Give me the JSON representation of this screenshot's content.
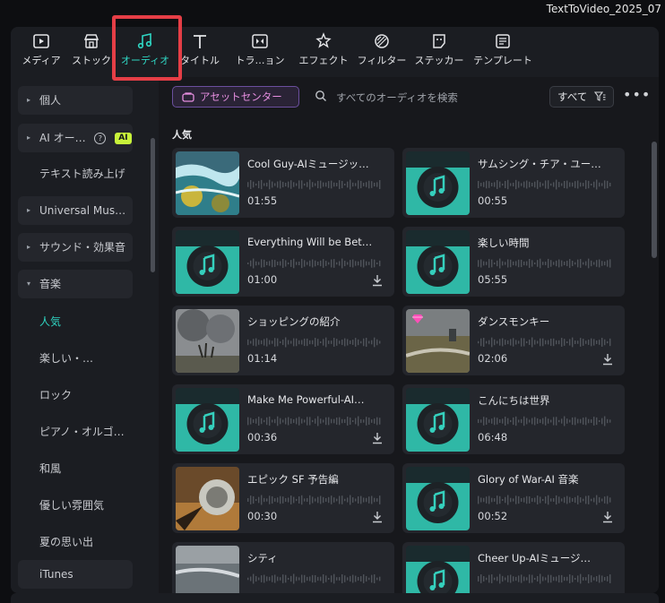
{
  "window": {
    "title": "TextToVideo_2025_07"
  },
  "toolbar": {
    "tabs": [
      {
        "label": "メディア",
        "icon": "media-icon"
      },
      {
        "label": "ストック",
        "icon": "stock-icon"
      },
      {
        "label": "オーディオ",
        "icon": "audio-icon",
        "active": true
      },
      {
        "label": "タイトル",
        "icon": "title-icon"
      },
      {
        "label": "トラ…ョン",
        "icon": "transition-icon"
      },
      {
        "label": "エフェクト",
        "icon": "effect-icon"
      },
      {
        "label": "フィルター",
        "icon": "filter-icon"
      },
      {
        "label": "ステッカー",
        "icon": "sticker-icon"
      },
      {
        "label": "テンプレート",
        "icon": "template-icon"
      }
    ]
  },
  "sidebar": {
    "items": [
      {
        "label": "個人",
        "arrow": "▸"
      },
      {
        "label": "AI オー…",
        "arrow": "▸",
        "help": "?",
        "badge": "AI"
      },
      {
        "label": "テキスト読み上げ"
      },
      {
        "label": "Universal Mus…",
        "arrow": "▸"
      },
      {
        "label": "サウンド・効果音",
        "arrow": "▸"
      },
      {
        "label": "音楽",
        "arrow": "▾"
      }
    ],
    "subitems": [
      {
        "label": "人気",
        "active": true
      },
      {
        "label": "楽しい・…"
      },
      {
        "label": "ロック"
      },
      {
        "label": "ピアノ・オルゴ…"
      },
      {
        "label": "和風"
      },
      {
        "label": "優しい雰囲気"
      },
      {
        "label": "夏の思い出"
      }
    ],
    "itunes": "iTunes"
  },
  "main": {
    "asset_center_label": "アセットセンター",
    "search_placeholder": "すべてのオーディオを検索",
    "filter_label": "すべて",
    "more_label": "•••",
    "section_title": "人気",
    "cards": [
      {
        "title": "Cool Guy-AIミュージッ…",
        "duration": "01:55",
        "thumb": "waves",
        "download": false
      },
      {
        "title": "サムシング・チア・ユー…",
        "duration": "00:55",
        "thumb": "disc",
        "download": false
      },
      {
        "title": "Everything Will be Bet…",
        "duration": "01:00",
        "thumb": "disc",
        "download": true
      },
      {
        "title": "楽しい時間",
        "duration": "05:55",
        "thumb": "disc",
        "download": false
      },
      {
        "title": "ショッピングの紹介",
        "duration": "01:14",
        "thumb": "storm",
        "download": false
      },
      {
        "title": "ダンスモンキー",
        "duration": "02:06",
        "thumb": "field",
        "download": true,
        "premium": true
      },
      {
        "title": "Make Me Powerful-AI…",
        "duration": "00:36",
        "thumb": "disc",
        "download": true
      },
      {
        "title": "こんにちは世界",
        "duration": "06:48",
        "thumb": "disc",
        "download": false
      },
      {
        "title": "エピック SF 予告編",
        "duration": "00:30",
        "thumb": "sphere",
        "download": true
      },
      {
        "title": "Glory of War-AI 音楽",
        "duration": "00:52",
        "thumb": "disc",
        "download": true
      },
      {
        "title": "シティ",
        "duration": "",
        "thumb": "shore",
        "download": false
      },
      {
        "title": "Cheer Up-AIミュージ…",
        "duration": "",
        "thumb": "disc",
        "download": false
      }
    ]
  },
  "colors": {
    "accent": "#2fd6c3",
    "highlight": "#e53e46",
    "asset_pink": "#e68fe0",
    "ai_badge": "#c8f23a"
  }
}
